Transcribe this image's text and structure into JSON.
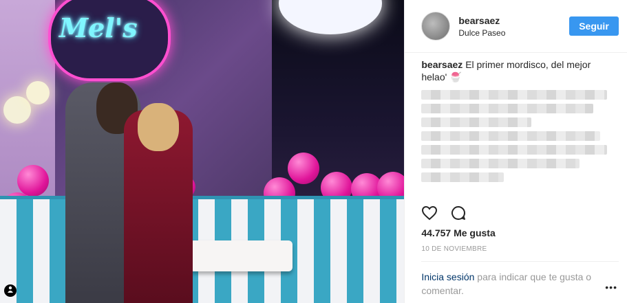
{
  "post": {
    "username": "bearsaez",
    "location": "Dulce Paseo",
    "follow_label": "Seguir",
    "caption_user": "bearsaez",
    "caption_text": "El primer mordisco, del mejor helao' 🍧",
    "likes": "44.757 Me gusta",
    "date": "10 DE NOVIEMBRE",
    "login_link": "Inicia sesión",
    "login_text": " para indicar que te gusta o comentar.",
    "more": "•••"
  },
  "photo": {
    "sign_text": "Mel's",
    "user_tag_icon": "person-icon"
  },
  "colors": {
    "follow_button": "#3897f0",
    "link": "#003569",
    "muted": "#999999"
  }
}
